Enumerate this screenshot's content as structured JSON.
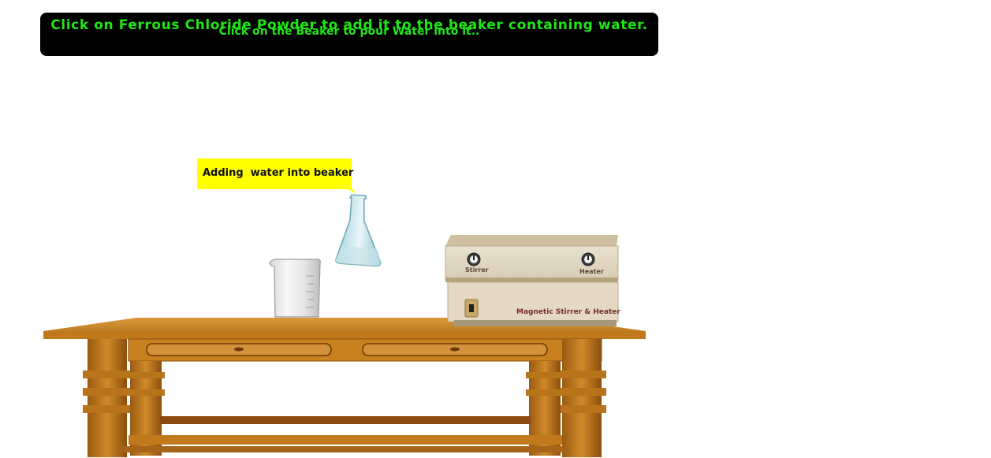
{
  "instructions": {
    "main": "Click on Ferrous Chloride Powder to add it to the beaker containing water.",
    "overlay": "Click on the Beaker to pour Water into it.."
  },
  "callout": {
    "text": "Adding  water into beaker"
  },
  "device": {
    "stirrer_label": "Stirrer",
    "heater_label": "Heater",
    "name": "Magnetic Stirrer & Heater"
  },
  "colors": {
    "instruction_bg": "#000000",
    "instruction_text": "#1ee614",
    "callout_bg": "#ffff00",
    "table_wood": "#c8811e",
    "device_body": "#e2d9c6"
  },
  "icons": [
    "beaker-icon",
    "flask-icon",
    "stirrer-knob-icon",
    "heater-knob-icon",
    "power-switch-icon"
  ]
}
